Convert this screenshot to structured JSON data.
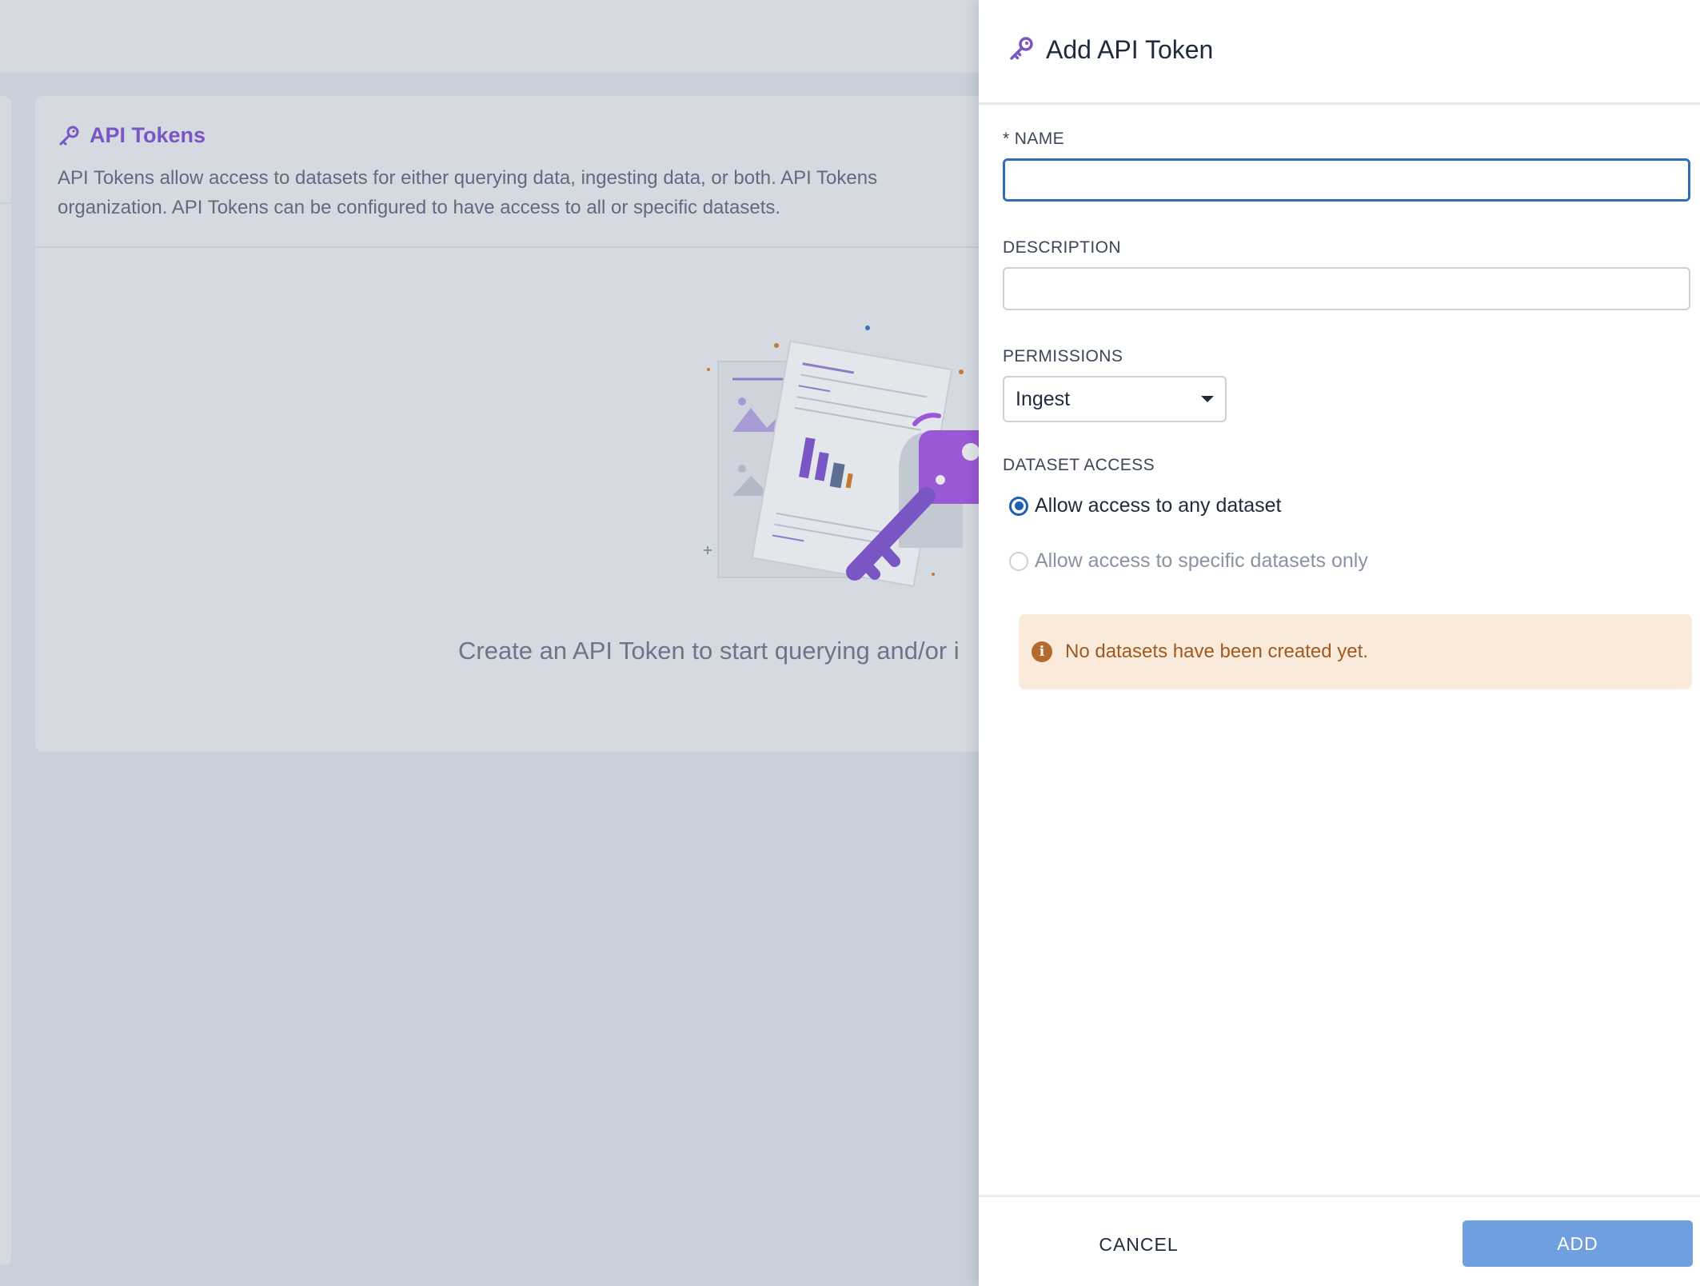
{
  "background": {
    "card": {
      "title": "API Tokens",
      "description_line1": "API Tokens allow access to datasets for either querying data, ingesting data, or both. API Tokens",
      "description_line2": "organization. API Tokens can be configured to have access to all or specific datasets.",
      "empty_message": "Create an API Token to start querying and/or i",
      "title_icon": "key-icon",
      "accent_color": "#7a56c4"
    }
  },
  "drawer": {
    "title": "Add API Token",
    "title_icon": "key-icon",
    "name": {
      "label": "* NAME",
      "value": ""
    },
    "description": {
      "label": "DESCRIPTION",
      "value": ""
    },
    "permissions": {
      "label": "PERMISSIONS",
      "selected": "Ingest"
    },
    "dataset_access": {
      "label": "DATASET ACCESS",
      "options": [
        {
          "label": "Allow access to any dataset",
          "selected": true
        },
        {
          "label": "Allow access to specific datasets only",
          "selected": false
        }
      ]
    },
    "alert": {
      "icon": "info-icon",
      "text": "No datasets have been created yet."
    },
    "cancel_label": "CANCEL",
    "add_label": "ADD",
    "colors": {
      "primary": "#1f5fae",
      "add_button": "#6f9fdf",
      "alert_bg": "#faeadb",
      "alert_text": "#a0591e"
    }
  }
}
